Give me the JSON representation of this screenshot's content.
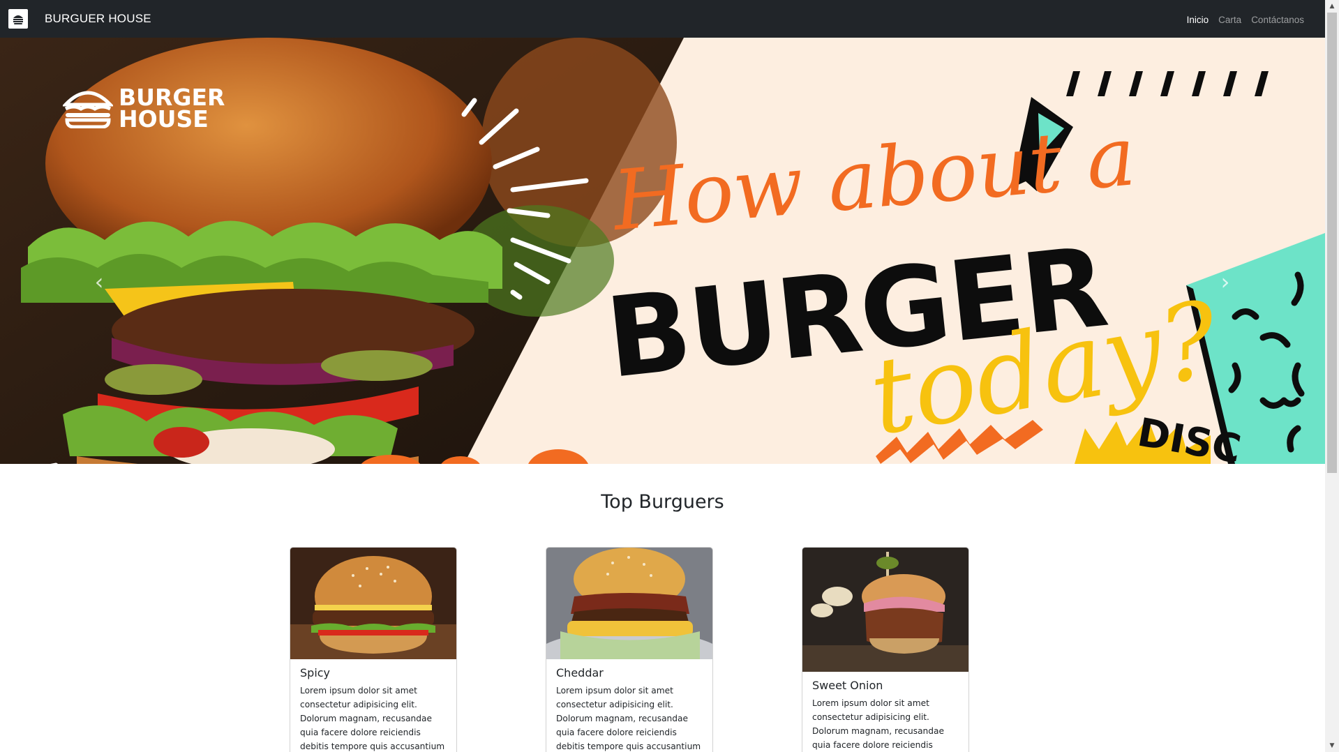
{
  "navbar": {
    "brand": "BURGUER HOUSE",
    "links": [
      {
        "label": "Inicio",
        "active": true
      },
      {
        "label": "Carta",
        "active": false
      },
      {
        "label": "Contáctanos",
        "active": false
      }
    ]
  },
  "hero": {
    "logo_line1": "BURGER",
    "logo_line2": "HOUSE",
    "script_text": "How about a",
    "big_text": "BURGER",
    "today_text": "today?",
    "disc_text": "DISC",
    "prev_glyph": "‹",
    "next_glyph": "›"
  },
  "section": {
    "title": "Top Burguers"
  },
  "cards": [
    {
      "title": "Spicy",
      "text": "Lorem ipsum dolor sit amet consectetur adipisicing elit. Dolorum magnam, recusandae quia facere dolore reiciendis debitis tempore quis accusantium cum"
    },
    {
      "title": "Cheddar",
      "text": "Lorem ipsum dolor sit amet consectetur adipisicing elit. Dolorum magnam, recusandae quia facere dolore reiciendis debitis tempore quis accusantium cum"
    },
    {
      "title": "Sweet Onion",
      "text": "Lorem ipsum dolor sit amet consectetur adipisicing elit. Dolorum magnam, recusandae quia facere dolore reiciendis debitis"
    }
  ],
  "colors": {
    "navbar_bg": "#212529",
    "hero_cream": "#fdeee0",
    "accent_orange": "#f26b21",
    "accent_yellow": "#f7c20f",
    "accent_teal": "#6de3c8"
  }
}
